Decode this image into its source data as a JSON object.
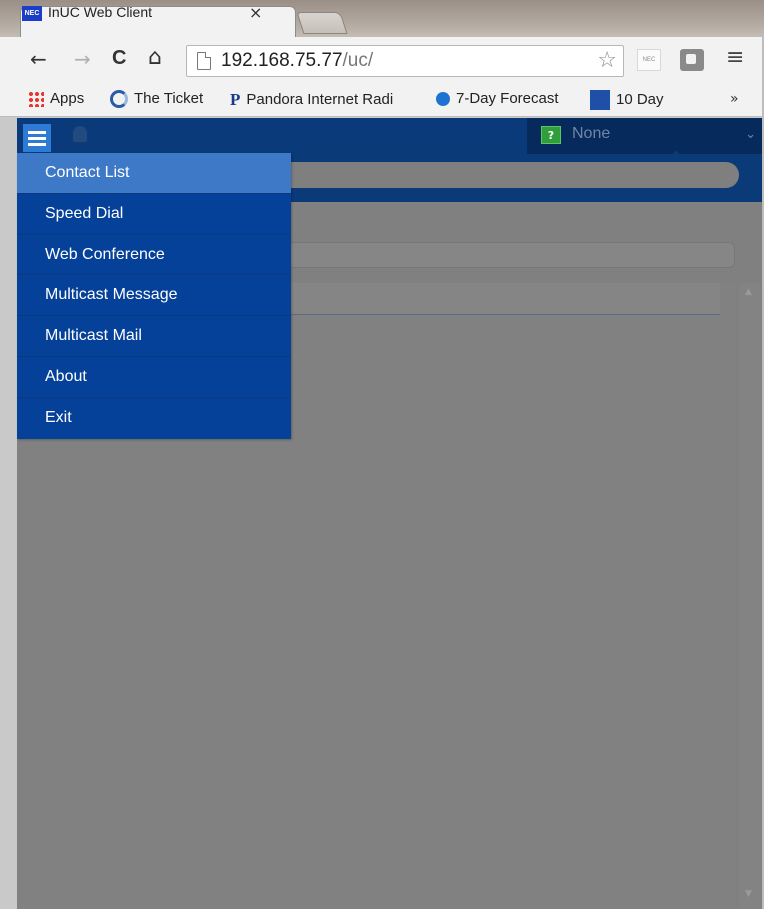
{
  "browser": {
    "tab": {
      "favicon_text": "NEC",
      "title": "InUC Web Client",
      "close_glyph": "×"
    },
    "toolbar": {
      "back_glyph": "←",
      "forward_glyph": "→",
      "reload_glyph": "C",
      "home_glyph": "⌂",
      "url_host": "192.168.75.77",
      "url_path": "/uc/",
      "star_glyph": "☆",
      "extension_nec_text": "NEC",
      "menu_glyph": "≡"
    },
    "bookmarks": [
      {
        "label": "Apps",
        "icon": "apps-grid-icon"
      },
      {
        "label": "The Ticket",
        "icon": "ticket-icon"
      },
      {
        "label": "Pandora Internet Radi",
        "icon": "pandora-icon",
        "icon_text": "P"
      },
      {
        "label": "7-Day Forecast",
        "icon": "noaa-icon"
      },
      {
        "label": "10 Day",
        "icon": "weather-channel-icon"
      }
    ],
    "bookmarks_more": "»"
  },
  "app": {
    "status": {
      "badge": "?",
      "label": "None",
      "caret": "⌄"
    },
    "menu": {
      "items": [
        {
          "label": "Contact List",
          "active": true
        },
        {
          "label": "Speed Dial",
          "active": false
        },
        {
          "label": "Web Conference",
          "active": false
        },
        {
          "label": "Multicast Message",
          "active": false
        },
        {
          "label": "Multicast Mail",
          "active": false
        },
        {
          "label": "About",
          "active": false
        },
        {
          "label": "Exit",
          "active": false
        }
      ]
    },
    "scroll": {
      "up": "▲",
      "down": "▼"
    }
  },
  "colors": {
    "header_blue": "#0b3a79",
    "menu_blue": "#064199",
    "menu_active": "#3d79c6",
    "overlay_gray": "#808080",
    "status_green": "#2f9e3b"
  }
}
